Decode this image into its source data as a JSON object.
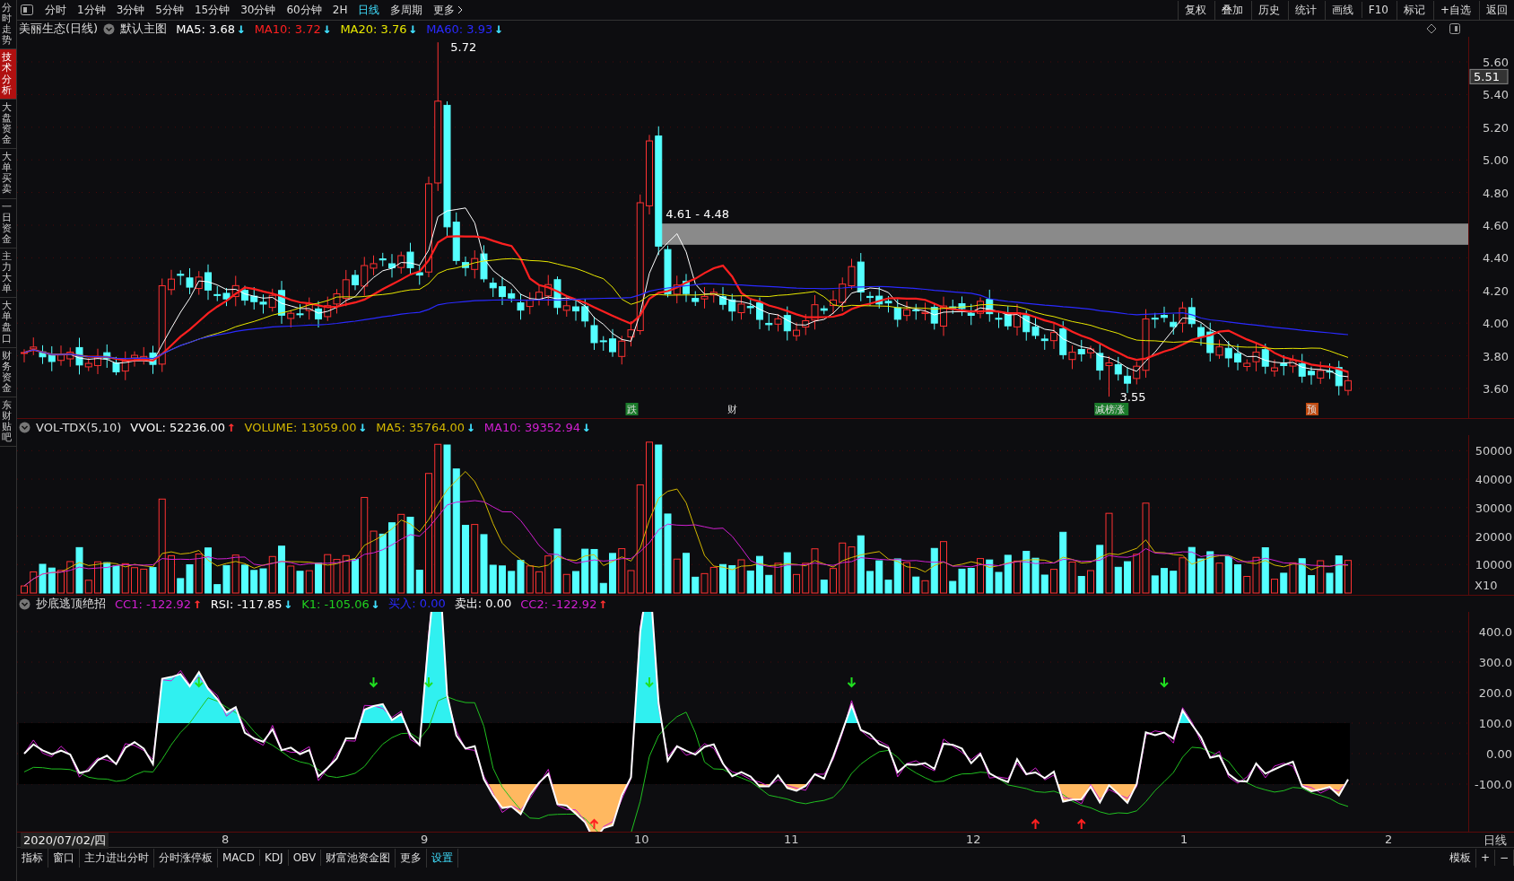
{
  "side_tabs": [
    {
      "label": "分时走势",
      "selected": false
    },
    {
      "label": "技术分析",
      "selected": true
    },
    {
      "label": "大盘资金",
      "selected": false
    },
    {
      "label": "大单买卖",
      "selected": false
    },
    {
      "label": "一日资金",
      "selected": false
    },
    {
      "label": "主力大单",
      "selected": false
    },
    {
      "label": "大单盘口",
      "selected": false
    },
    {
      "label": "财务资金",
      "selected": false
    },
    {
      "label": "东财贴吧",
      "selected": false
    }
  ],
  "toolbar": {
    "periods": [
      {
        "label": "分时",
        "selected": false
      },
      {
        "label": "1分钟",
        "selected": false
      },
      {
        "label": "3分钟",
        "selected": false
      },
      {
        "label": "5分钟",
        "selected": false
      },
      {
        "label": "15分钟",
        "selected": false
      },
      {
        "label": "30分钟",
        "selected": false
      },
      {
        "label": "60分钟",
        "selected": false
      },
      {
        "label": "2H",
        "selected": false
      },
      {
        "label": "日线",
        "selected": true
      },
      {
        "label": "多周期",
        "selected": false
      }
    ],
    "more": "更多",
    "actions": [
      "复权",
      "叠加",
      "历史",
      "统计",
      "画线",
      "F10",
      "标记",
      "+自选",
      "返回"
    ]
  },
  "main_chart": {
    "title": "美丽生态(日线)",
    "template": "默认主图",
    "indicators": [
      {
        "label": "MA5: 3.68",
        "color": "#ffffff",
        "arrow": {
          "text": "↓",
          "color": "#40e0ff"
        }
      },
      {
        "label": "MA10: 3.72",
        "color": "#ff2020",
        "arrow": {
          "text": "↓",
          "color": "#40e0ff"
        }
      },
      {
        "label": "MA20: 3.76",
        "color": "#e8e800",
        "arrow": {
          "text": "↓",
          "color": "#40e0ff"
        }
      },
      {
        "label": "MA60: 3.93",
        "color": "#2a2aff",
        "arrow": {
          "text": "↓",
          "color": "#40e0ff"
        }
      }
    ],
    "y_axis": [
      "5.60",
      "5.40",
      "5.20",
      "5.00",
      "4.80",
      "4.60",
      "4.40",
      "4.20",
      "4.00",
      "3.80",
      "3.60"
    ],
    "current_price": "5.51",
    "high_label": "5.72",
    "gap_label": "4.61 - 4.48",
    "low_label": "3.55",
    "event_markers": [
      {
        "label": "跌",
        "color": "#1a7a2a"
      },
      {
        "label": "财"
      },
      {
        "label": "减榜涨",
        "color": "#1a7a2a"
      },
      {
        "label": "预",
        "color": "#c04a10"
      }
    ]
  },
  "volume_chart": {
    "title": "VOL-TDX(5,10)",
    "indicators": [
      {
        "label": "VVOL: 52236.00",
        "color": "#ffffff",
        "arrow": {
          "text": "↑",
          "color": "#ff3030"
        }
      },
      {
        "label": "VOLUME: 13059.00",
        "color": "#d4b800",
        "arrow": {
          "text": "↓",
          "color": "#40e0ff"
        }
      },
      {
        "label": "MA5: 35764.00",
        "color": "#d4b800",
        "arrow": {
          "text": "↓",
          "color": "#40e0ff"
        }
      },
      {
        "label": "MA10: 39352.94",
        "color": "#d020d0",
        "arrow": {
          "text": "↓",
          "color": "#40e0ff"
        }
      }
    ],
    "y_axis": [
      "50000",
      "40000",
      "30000",
      "20000",
      "10000"
    ],
    "unit": "X10"
  },
  "oscillator_chart": {
    "title": "抄底逃顶绝招",
    "indicators": [
      {
        "label": "CC1: -122.92",
        "color": "#d020d0",
        "arrow": {
          "text": "↑",
          "color": "#ff3030"
        }
      },
      {
        "label": "RSI: -117.85",
        "color": "#ffffff",
        "arrow": {
          "text": "↓",
          "color": "#40e0ff"
        }
      },
      {
        "label": "K1: -105.06",
        "color": "#20d020",
        "arrow": {
          "text": "↓",
          "color": "#40e0ff"
        }
      },
      {
        "label": "买入: 0.00",
        "color": "#2a2aff"
      },
      {
        "label": "卖出: 0.00",
        "color": "#ffffff"
      },
      {
        "label": "CC2: -122.92",
        "color": "#d020d0",
        "arrow": {
          "text": "↑",
          "color": "#ff3030"
        }
      }
    ],
    "y_axis": [
      "400.0",
      "300.0",
      "200.0",
      "100.0",
      "0.00",
      "-100.0"
    ]
  },
  "date_axis": {
    "cursor_date": "2020/07/02/四",
    "months": [
      "8",
      "9",
      "10",
      "11",
      "12",
      "1",
      "2"
    ],
    "period": "日线"
  },
  "bottom_tabs": [
    {
      "label": "指标",
      "selected": false
    },
    {
      "label": "窗口",
      "selected": false
    },
    {
      "label": "主力进出分时",
      "selected": false
    },
    {
      "label": "分时涨停板",
      "selected": false
    },
    {
      "label": "MACD",
      "selected": false
    },
    {
      "label": "KDJ",
      "selected": false
    },
    {
      "label": "OBV",
      "selected": false
    },
    {
      "label": "财富池资金图",
      "selected": false
    },
    {
      "label": "更多",
      "selected": false
    },
    {
      "label": "设置",
      "selected": true
    }
  ],
  "bottom_actions": [
    "模板",
    "+",
    "−"
  ]
}
